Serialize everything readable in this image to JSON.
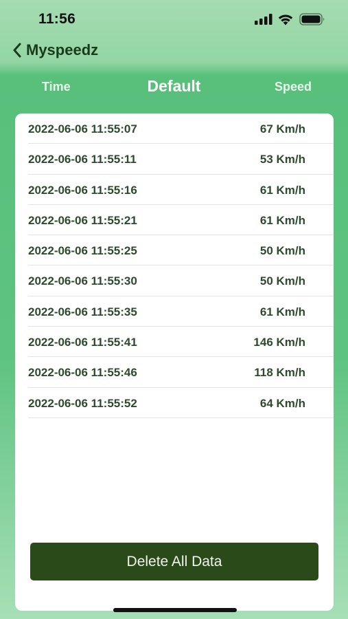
{
  "status_bar": {
    "time": "11:56"
  },
  "nav": {
    "back_label": "Myspeedz"
  },
  "header": {
    "left_label": "Time",
    "title": "Default",
    "right_label": "Speed"
  },
  "records": [
    {
      "time": "2022-06-06 11:55:07",
      "speed": "67 Km/h"
    },
    {
      "time": "2022-06-06 11:55:11",
      "speed": "53 Km/h"
    },
    {
      "time": "2022-06-06 11:55:16",
      "speed": "61 Km/h"
    },
    {
      "time": "2022-06-06 11:55:21",
      "speed": "61 Km/h"
    },
    {
      "time": "2022-06-06 11:55:25",
      "speed": "50 Km/h"
    },
    {
      "time": "2022-06-06 11:55:30",
      "speed": "50 Km/h"
    },
    {
      "time": "2022-06-06 11:55:35",
      "speed": "61 Km/h"
    },
    {
      "time": "2022-06-06 11:55:41",
      "speed": "146 Km/h"
    },
    {
      "time": "2022-06-06 11:55:46",
      "speed": "118 Km/h"
    },
    {
      "time": "2022-06-06 11:55:52",
      "speed": "64 Km/h"
    }
  ],
  "actions": {
    "delete_label": "Delete All Data"
  },
  "icons": {
    "signal": "cellular-signal-icon",
    "wifi": "wifi-icon",
    "battery": "battery-icon",
    "back": "chevron-left-icon"
  },
  "colors": {
    "accent_green": "#5ec381",
    "button_dark_green": "#2b4a19",
    "row_text": "#2c4b2c"
  }
}
